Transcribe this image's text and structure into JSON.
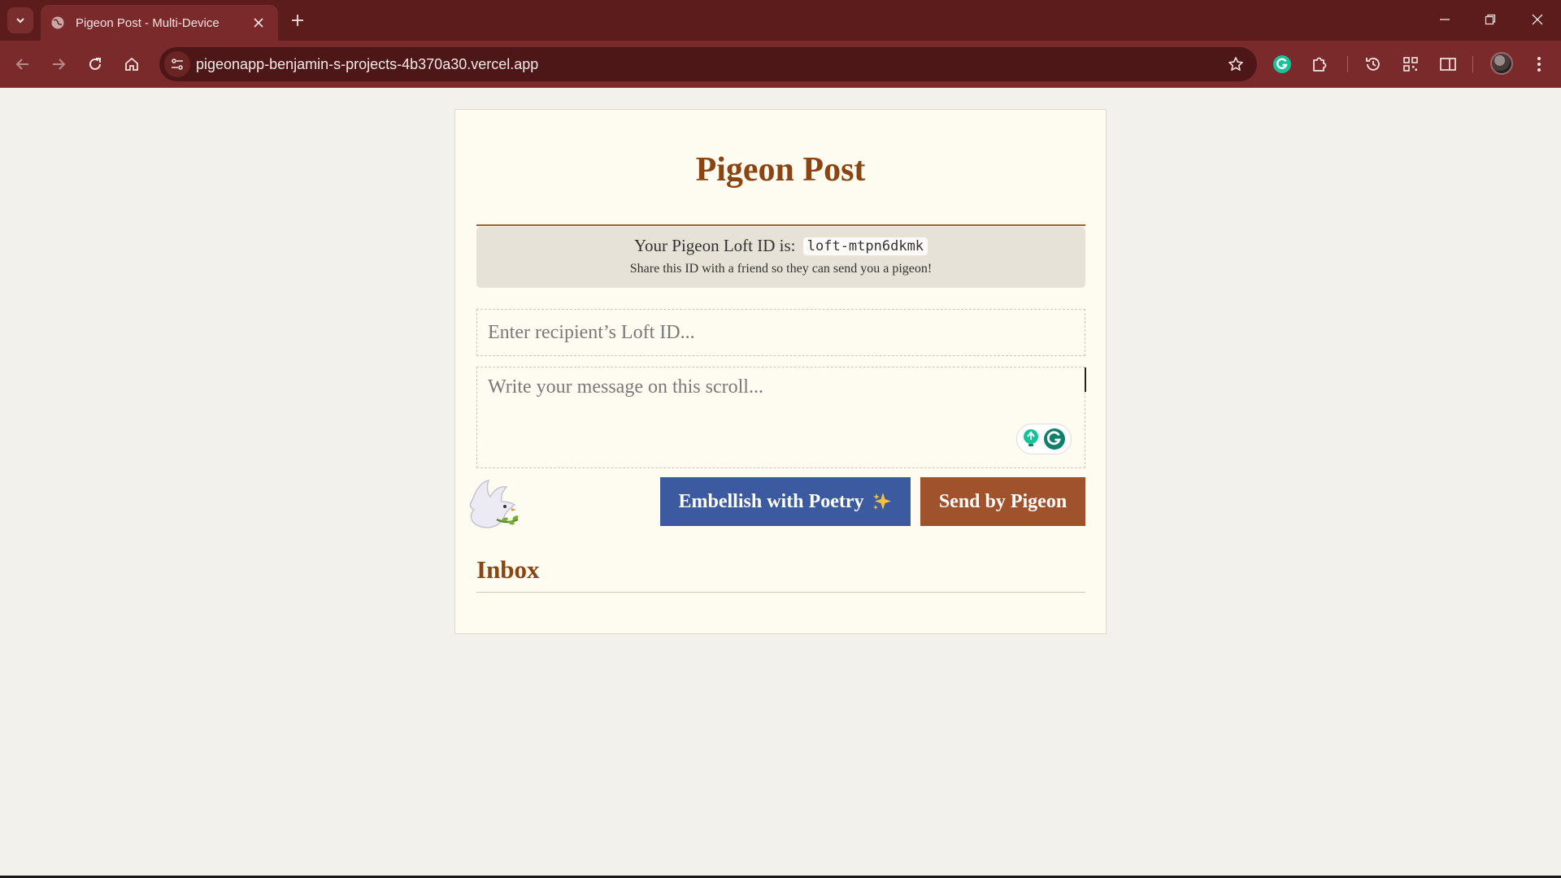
{
  "browser": {
    "tab_title": "Pigeon Post - Multi-Device",
    "url": "pigeonapp-benjamin-s-projects-4b370a30.vercel.app"
  },
  "app": {
    "title": "Pigeon Post",
    "loft_label": "Your Pigeon Loft ID is:",
    "loft_id": "loft-mtpn6dkmk",
    "loft_hint": "Share this ID with a friend so they can send you a pigeon!",
    "recipient_placeholder": "Enter recipient’s Loft ID...",
    "message_placeholder": "Write your message on this scroll...",
    "poetry_button": "Embellish with Poetry",
    "send_button": "Send by Pigeon",
    "inbox_title": "Inbox"
  },
  "colors": {
    "chrome_tabbar": "#5c1c1c",
    "chrome_toolbar": "#7a2a2a",
    "title_brown": "#8b4513",
    "poetry_blue": "#3b5aa0",
    "send_brown": "#a0522d"
  },
  "icons": {
    "tab_list": "chevron-down-icon",
    "favicon": "globe-icon",
    "tab_close": "close-icon",
    "new_tab": "plus-icon",
    "back": "arrow-left-icon",
    "forward": "arrow-right-icon",
    "reload": "reload-icon",
    "home": "home-icon",
    "site_info": "tune-icon",
    "bookmark": "star-icon",
    "grammarly": "grammarly-icon",
    "extensions": "puzzle-icon",
    "history": "history-icon",
    "qr": "qr-icon",
    "sidebar": "sidebar-icon",
    "menu": "kebab-menu-icon",
    "dove": "dove-icon",
    "sparkle": "sparkles-icon"
  }
}
